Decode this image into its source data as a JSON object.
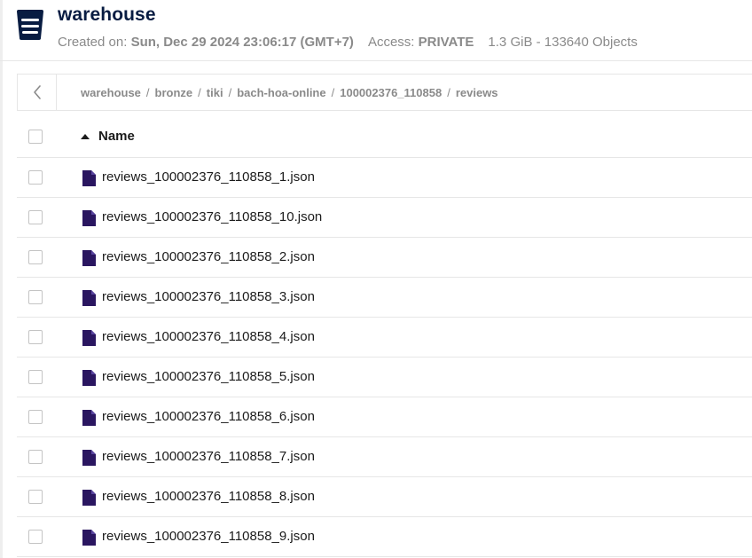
{
  "bucket": {
    "title": "warehouse",
    "created_label": "Created on:",
    "created_value": "Sun, Dec 29 2024 23:06:17 (GMT+7)",
    "access_label": "Access:",
    "access_value": "PRIVATE",
    "usage": "1.3 GiB - 133640 Objects"
  },
  "breadcrumb": {
    "items": [
      "warehouse",
      "bronze",
      "tiki",
      "bach-hoa-online",
      "100002376_110858",
      "reviews"
    ],
    "separator": "/"
  },
  "table": {
    "column_name": "Name",
    "sort": "ascending",
    "rows": [
      {
        "name": "reviews_100002376_110858_1.json"
      },
      {
        "name": "reviews_100002376_110858_10.json"
      },
      {
        "name": "reviews_100002376_110858_2.json"
      },
      {
        "name": "reviews_100002376_110858_3.json"
      },
      {
        "name": "reviews_100002376_110858_4.json"
      },
      {
        "name": "reviews_100002376_110858_5.json"
      },
      {
        "name": "reviews_100002376_110858_6.json"
      },
      {
        "name": "reviews_100002376_110858_7.json"
      },
      {
        "name": "reviews_100002376_110858_8.json"
      },
      {
        "name": "reviews_100002376_110858_9.json"
      }
    ]
  },
  "icons": {
    "bucket": "bucket-icon",
    "back": "chevron-left-icon",
    "sort": "sort-ascending-icon",
    "file": "file-icon"
  },
  "colors": {
    "brand": "#081c42",
    "file_icon": "#2a1660",
    "muted_text": "#8a8a8a",
    "border": "#e6e6e6"
  }
}
